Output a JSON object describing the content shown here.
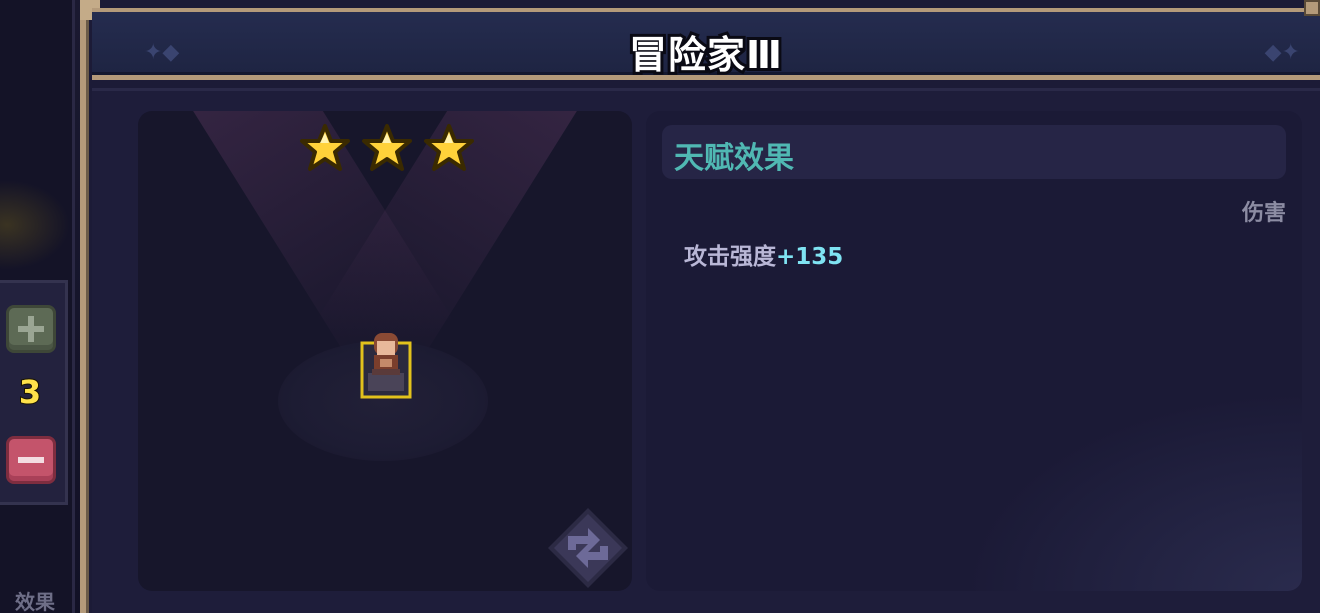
{
  "window": {
    "title": "冒险家Ⅲ"
  },
  "preview": {
    "star_count": 3,
    "stars_filled": 3,
    "hero_icon": "hero-portrait-icon",
    "swap_icon": "swap-arrows-icon"
  },
  "talent": {
    "header": "天赋效果",
    "tag": "伤害",
    "effect_label": "攻击强度",
    "effect_value": "+135"
  },
  "side_panel": {
    "count": "3",
    "plus_icon": "plus-icon",
    "minus_icon": "minus-icon",
    "tab_label": "效果"
  },
  "colors": {
    "frame": "#b49a7a",
    "title_text": "#ffffff",
    "header_text": "#50b8b3",
    "effect_value": "#7fe3f2",
    "count_text": "#ffe24a",
    "star": "#ffd23a"
  }
}
